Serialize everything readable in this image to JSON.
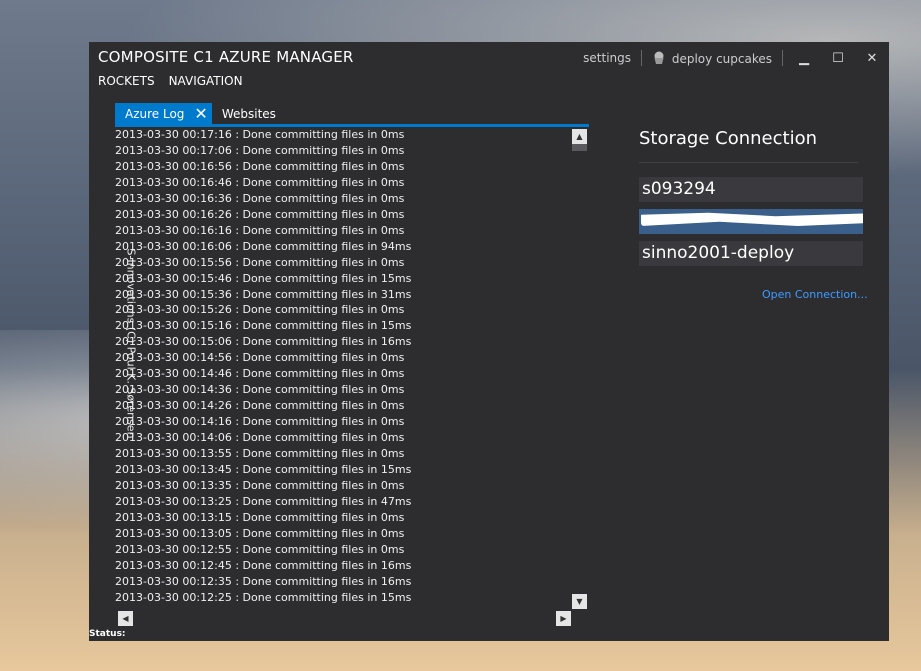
{
  "window": {
    "title": "COMPOSITE C1 AZURE MANAGER",
    "settings_label": "settings",
    "deploy_label": "deploy cupcakes",
    "minimize_glyph": "▁",
    "maximize_glyph": "☐",
    "close_glyph": "✕"
  },
  "menu": {
    "items": [
      "ROCKETS",
      "NAVIGATION"
    ]
  },
  "side_label": "S-Innovations (C) Poul K. Sørensen",
  "tabs": [
    {
      "label": "Azure Log",
      "close_glyph": "✕"
    },
    {
      "label": "Websites"
    }
  ],
  "log": [
    "2013-03-30 00:17:16 : Done committing files in 0ms",
    "2013-03-30 00:17:06 : Done committing files in 0ms",
    "2013-03-30 00:16:56 : Done committing files in 0ms",
    "2013-03-30 00:16:46 : Done committing files in 0ms",
    "2013-03-30 00:16:36 : Done committing files in 0ms",
    "2013-03-30 00:16:26 : Done committing files in 0ms",
    "2013-03-30 00:16:16 : Done committing files in 0ms",
    "2013-03-30 00:16:06 : Done committing files in 94ms",
    "2013-03-30 00:15:56 : Done committing files in 0ms",
    "2013-03-30 00:15:46 : Done committing files in 15ms",
    "2013-03-30 00:15:36 : Done committing files in 31ms",
    "2013-03-30 00:15:26 : Done committing files in 0ms",
    "2013-03-30 00:15:16 : Done committing files in 15ms",
    "2013-03-30 00:15:06 : Done committing files in 16ms",
    "2013-03-30 00:14:56 : Done committing files in 0ms",
    "2013-03-30 00:14:46 : Done committing files in 0ms",
    "2013-03-30 00:14:36 : Done committing files in 0ms",
    "2013-03-30 00:14:26 : Done committing files in 0ms",
    "2013-03-30 00:14:16 : Done committing files in 0ms",
    "2013-03-30 00:14:06 : Done committing files in 0ms",
    "2013-03-30 00:13:55 : Done committing files in 0ms",
    "2013-03-30 00:13:45 : Done committing files in 15ms",
    "2013-03-30 00:13:35 : Done committing files in 0ms",
    "2013-03-30 00:13:25 : Done committing files in 47ms",
    "2013-03-30 00:13:15 : Done committing files in 0ms",
    "2013-03-30 00:13:05 : Done committing files in 0ms",
    "2013-03-30 00:12:55 : Done committing files in 0ms",
    "2013-03-30 00:12:45 : Done committing files in 16ms",
    "2013-03-30 00:12:35 : Done committing files in 16ms",
    "2013-03-30 00:12:25 : Done committing files in 15ms"
  ],
  "scroll": {
    "up_glyph": "▲",
    "down_glyph": "▼",
    "left_glyph": "◀",
    "right_glyph": "▶"
  },
  "status_label": "Status:",
  "storage": {
    "title": "Storage Connection",
    "account_name": "s093294",
    "account_key": "",
    "container": "sinno2001-deploy",
    "open_label": "Open Connection..."
  },
  "colors": {
    "accent": "#007acc",
    "window_bg": "#2d2d30",
    "link": "#3e9bff",
    "field_bg": "#3a3a3e"
  },
  "icons": {
    "deploy": "cupcake-icon"
  }
}
